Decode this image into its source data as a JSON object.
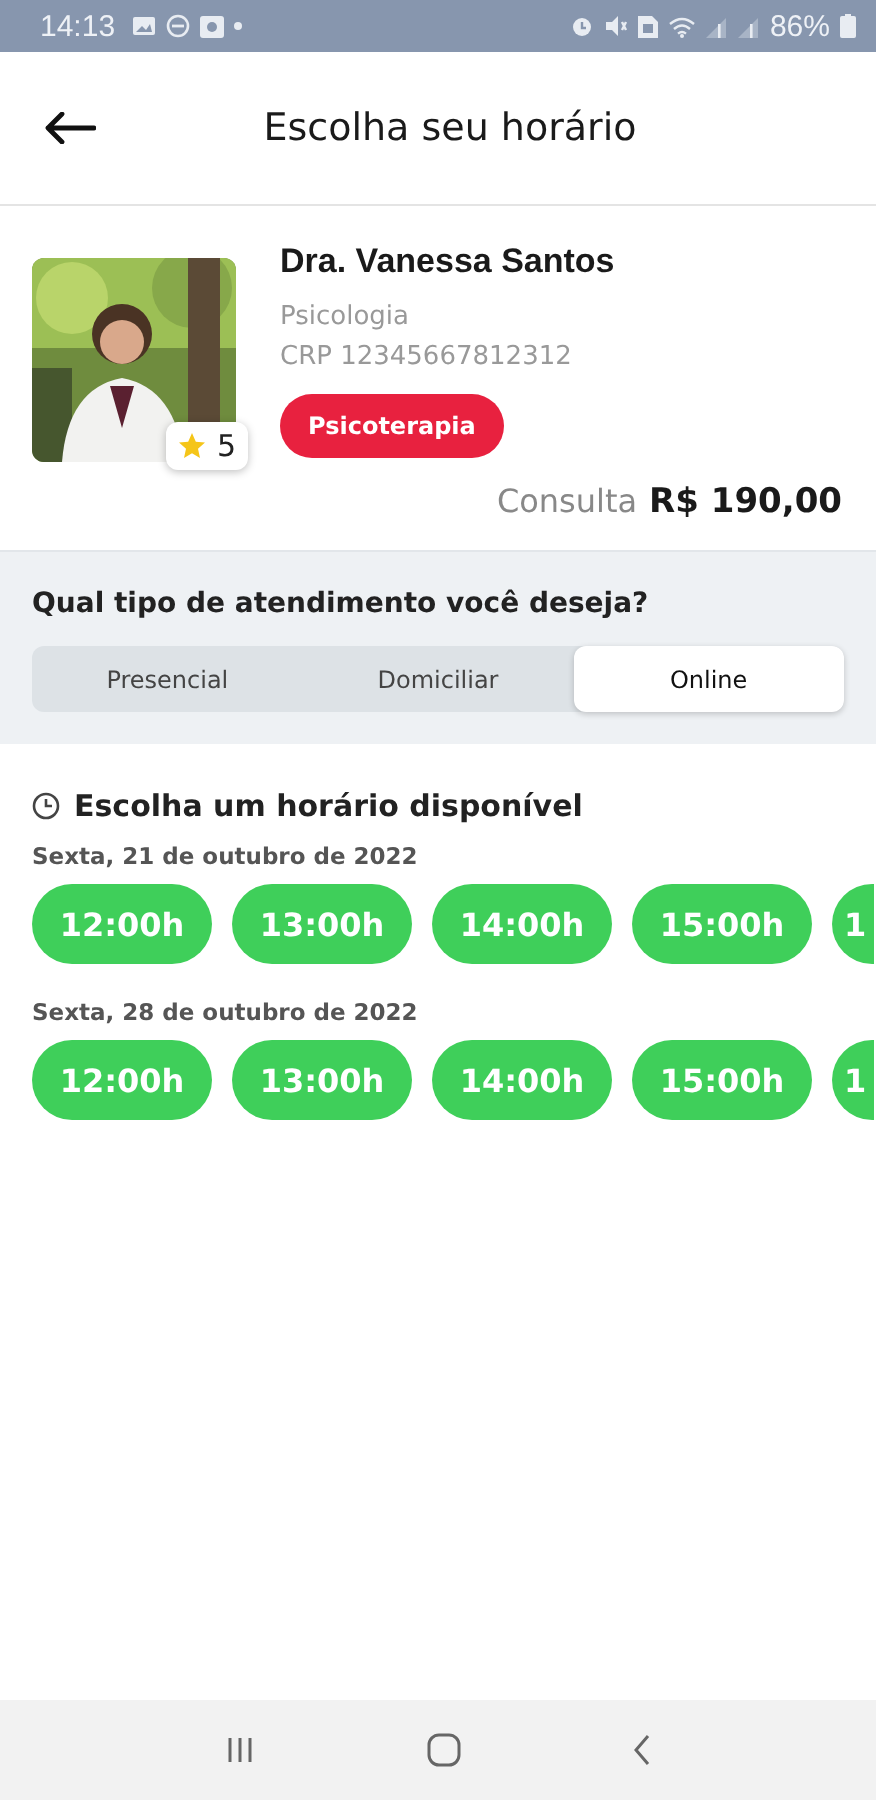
{
  "status_bar": {
    "time": "14:13",
    "battery": "86%"
  },
  "header": {
    "title": "Escolha seu horário"
  },
  "doctor": {
    "name": "Dra. Vanessa Santos",
    "specialty": "Psicologia",
    "registration": "CRP 12345667812312",
    "rating": "5",
    "tag": "Psicoterapia",
    "price_label": "Consulta",
    "price": "R$ 190,00"
  },
  "service": {
    "question": "Qual tipo de atendimento você deseja?",
    "options": [
      {
        "label": "Presencial",
        "selected": false
      },
      {
        "label": "Domiciliar",
        "selected": false
      },
      {
        "label": "Online",
        "selected": true
      }
    ]
  },
  "schedule": {
    "title": "Escolha um horário disponível",
    "days": [
      {
        "date": "Sexta, 21 de outubro de 2022",
        "slots": [
          {
            "time": "12:00h",
            "kind": "full"
          },
          {
            "time": "13:00h",
            "kind": "full"
          },
          {
            "time": "14:00h",
            "kind": "full"
          },
          {
            "time": "15:00h",
            "kind": "full"
          },
          {
            "time": "1",
            "kind": "partial"
          }
        ]
      },
      {
        "date": "Sexta, 28 de outubro de 2022",
        "slots": [
          {
            "time": "12:00h",
            "kind": "full"
          },
          {
            "time": "13:00h",
            "kind": "full"
          },
          {
            "time": "14:00h",
            "kind": "full"
          },
          {
            "time": "15:00h",
            "kind": "full"
          },
          {
            "time": "1",
            "kind": "partial"
          }
        ]
      }
    ]
  }
}
